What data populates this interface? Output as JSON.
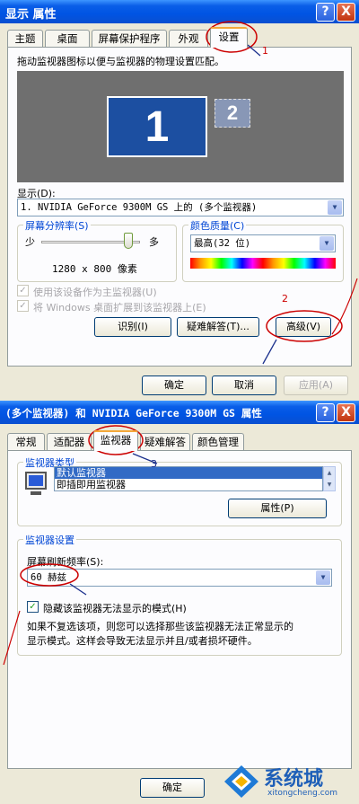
{
  "dialog1": {
    "title": "显示 属性",
    "tabs": [
      "主题",
      "桌面",
      "屏幕保护程序",
      "外观",
      "设置"
    ],
    "description": "拖动监视器图标以便与监视器的物理设置匹配。",
    "monitor_primary": "1",
    "monitor_secondary": "2",
    "display_label": "显示(D):",
    "display_value": "1. NVIDIA GeForce 9300M GS 上的 (多个监视器)",
    "resolution_group": "屏幕分辨率(S)",
    "slider_min_label": "少",
    "slider_max_label": "多",
    "resolution_value": "1280 x 800 像素",
    "color_group": "颜色质量(C)",
    "color_value": "最高(32 位)",
    "checkbox_primary": "使用该设备作为主监视器(U)",
    "checkbox_extend": "将 Windows 桌面扩展到该监视器上(E)",
    "identify_button": "识别(I)",
    "troubleshoot_button": "疑难解答(T)...",
    "advanced_button": "高级(V)",
    "ok_button": "确定",
    "cancel_button": "取消",
    "apply_button": "应用(A)"
  },
  "dialog2": {
    "title": "(多个监视器) 和 NVIDIA GeForce 9300M GS 属性",
    "tabs": [
      "常规",
      "适配器",
      "监视器",
      "疑难解答",
      "颜色管理"
    ],
    "monitor_type_group": "监视器类型",
    "monitor_list": [
      "默认监视器",
      "即插即用监视器"
    ],
    "properties_button": "属性(P)",
    "monitor_settings_group": "监视器设置",
    "refresh_label": "屏幕刷新频率(S):",
    "refresh_value": "60 赫兹",
    "hide_modes_checkbox": "隐藏该监视器无法显示的模式(H)",
    "hide_modes_help": [
      "如果不复选该项，则您可以选择那些该监视器无法正常显示的",
      "显示模式。这样会导致无法显示并且/或者损坏硬件。"
    ],
    "ok_button": "确定"
  },
  "annotations": [
    "1",
    "2",
    "3"
  ],
  "watermark": {
    "brand": "系统城",
    "url": "xitongcheng.com"
  },
  "window_buttons": {
    "help": "?",
    "close": "X"
  },
  "colors": {
    "titlebar": "#0054e3",
    "annotation": "#cc0000",
    "selection": "#316ac5",
    "monitor_primary": "#1c4fa1"
  }
}
